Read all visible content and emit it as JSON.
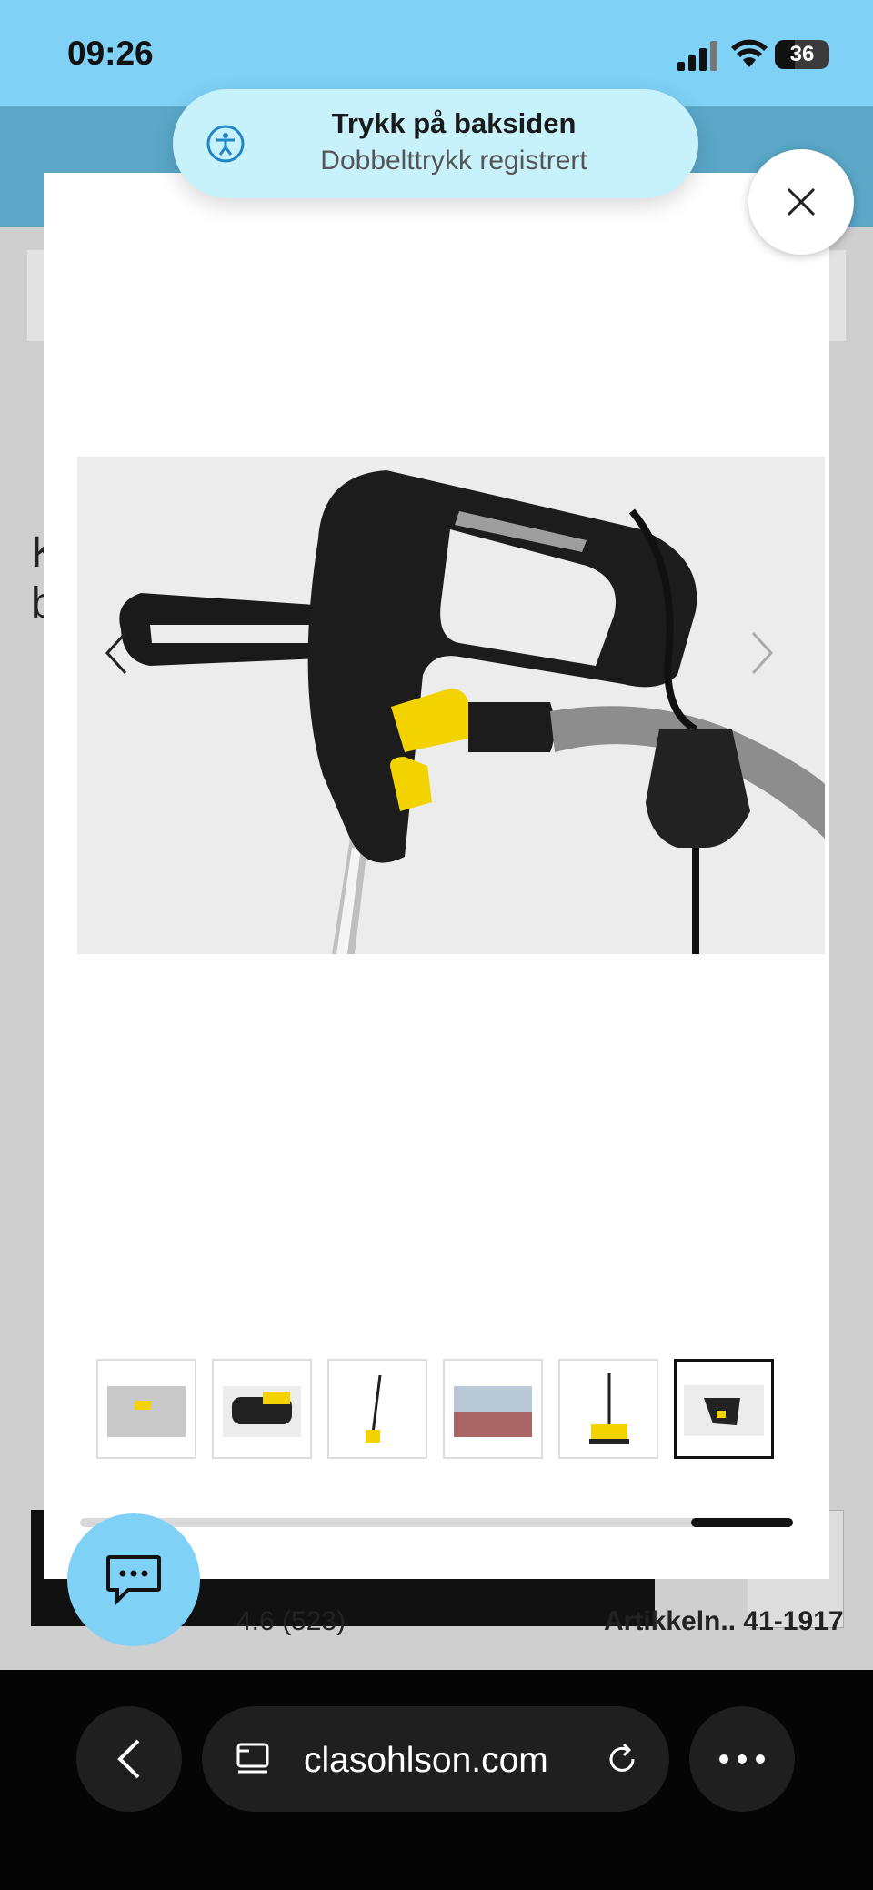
{
  "status_bar": {
    "time": "09:26",
    "battery_level": "36",
    "signal_icon": "cellular-signal-icon",
    "wifi_icon": "wifi-icon"
  },
  "background": {
    "letters": [
      "K",
      "b"
    ],
    "rating": "4.6",
    "rating_count": "(523)",
    "article_label": "Artikkeln..",
    "article_number": "41-1917"
  },
  "toast": {
    "title": "Trykk på baksiden",
    "subtitle": "Dobbelttrykk registrert",
    "icon": "accessibility-icon"
  },
  "gallery": {
    "thumbnails": [
      {
        "label": "cleaning deck"
      },
      {
        "label": "brush roller"
      },
      {
        "label": "product upright"
      },
      {
        "label": "outdoor scene"
      },
      {
        "label": "product front"
      },
      {
        "label": "handle detail"
      }
    ],
    "active_index": 5,
    "scroll_position": 0.86
  },
  "browser": {
    "url": "clasohlson.com"
  },
  "colors": {
    "accent_blue": "#7fd1f5",
    "brand_yellow": "#f2d300",
    "dark": "#111111"
  }
}
